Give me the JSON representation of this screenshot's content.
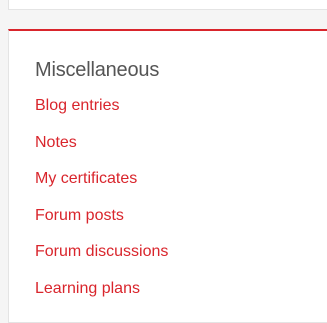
{
  "section": {
    "title": "Miscellaneous",
    "links": [
      {
        "label": "Blog entries"
      },
      {
        "label": "Notes"
      },
      {
        "label": "My certificates"
      },
      {
        "label": "Forum posts"
      },
      {
        "label": "Forum discussions"
      },
      {
        "label": "Learning plans"
      }
    ]
  },
  "colors": {
    "accent": "#d9252c",
    "title": "#555555",
    "background": "#f5f5f5"
  }
}
